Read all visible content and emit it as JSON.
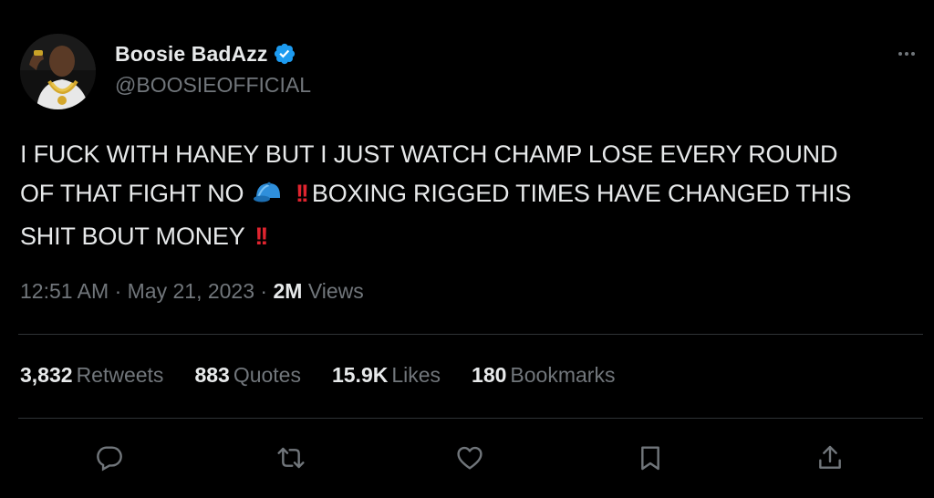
{
  "user": {
    "display_name": "Boosie BadAzz",
    "handle": "@BOOSIEOFFICIAL",
    "verified": true,
    "verified_color": "#1d9bf0"
  },
  "tweet": {
    "line1": "I FUCK WITH HANEY BUT I JUST WATCH CHAMP LOSE EVERY ROUND",
    "line2_a": "OF THAT FIGHT NO",
    "line2_emoji_cap": "billed-cap-emoji",
    "line2_bang": "!!",
    "line2_b": "BOXING RIGGED TIMES HAVE CHANGED THIS",
    "line3_a": "SHIT BOUT MONEY",
    "line3_bang": "!!"
  },
  "meta": {
    "time": "12:51 AM",
    "separator": "·",
    "date": "May 21, 2023",
    "views_count": "2M",
    "views_label": "Views"
  },
  "stats": [
    {
      "count": "3,832",
      "label": "Retweets"
    },
    {
      "count": "883",
      "label": "Quotes"
    },
    {
      "count": "15.9K",
      "label": "Likes"
    },
    {
      "count": "180",
      "label": "Bookmarks"
    }
  ],
  "actions": [
    "reply-icon",
    "retweet-icon",
    "like-icon",
    "bookmark-icon",
    "share-icon"
  ],
  "colors": {
    "background": "#000000",
    "text_primary": "#e7e9ea",
    "text_secondary": "#71767b",
    "divider": "#2f3336",
    "accent_red": "#e0242f"
  }
}
